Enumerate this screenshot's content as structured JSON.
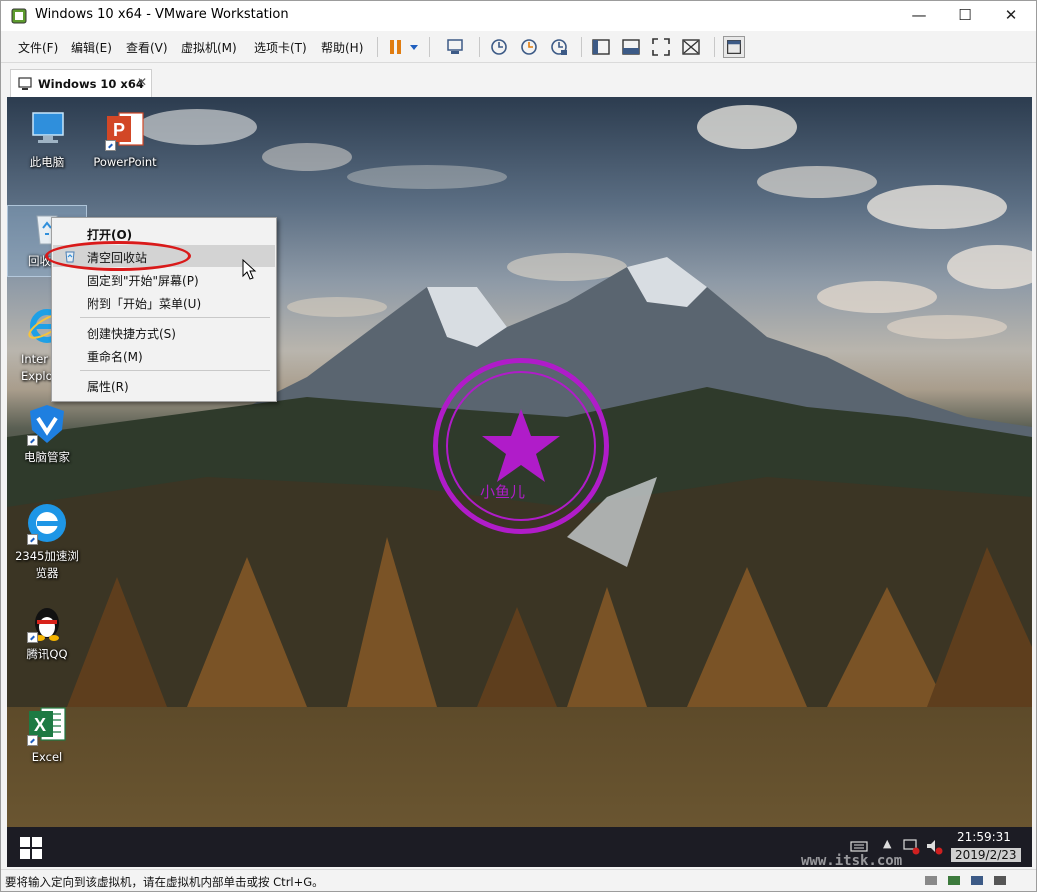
{
  "window": {
    "title": "Windows 10 x64 - VMware Workstation",
    "controls": {
      "minimize": "—",
      "maximize": "☐",
      "close": "✕"
    }
  },
  "menubar": {
    "items": [
      "文件(F)",
      "编辑(E)",
      "查看(V)",
      "虚拟机(M)",
      "选项卡(T)",
      "帮助(H)"
    ]
  },
  "toolbar": {
    "icons": [
      "pause-icon",
      "dropdown-icon",
      "send-ctrl-alt-del-icon",
      "snapshot-icon",
      "revert-snapshot-icon",
      "snapshot-manager-icon",
      "sidebar-icon",
      "console-view-icon",
      "fullscreen-icon",
      "unity-icon",
      "library-icon"
    ]
  },
  "tab": {
    "label": "Windows 10 x64",
    "close": "✕"
  },
  "desktop": {
    "icons": [
      {
        "label": "此电脑",
        "icon": "this-pc-icon"
      },
      {
        "label": "PowerPoint",
        "icon": "powerpoint-icon"
      },
      {
        "label": "回收",
        "icon": "recycle-bin-icon"
      },
      {
        "label": "Inter\nExplo",
        "icon": "internet-explorer-icon"
      },
      {
        "label": "电脑管家",
        "icon": "pc-manager-icon"
      },
      {
        "label": "2345加速浏览器",
        "icon": "browser-2345-icon"
      },
      {
        "label": "腾讯QQ",
        "icon": "qq-icon"
      },
      {
        "label": "Excel",
        "icon": "excel-icon"
      }
    ]
  },
  "context_menu": {
    "items": [
      {
        "label": "打开(O)",
        "bold": true
      },
      {
        "label": "清空回收站",
        "highlighted": true
      },
      {
        "label": "固定到\"开始\"屏幕(P)"
      },
      {
        "label": "附到「开始」菜单(U)"
      },
      {
        "label": "创建快捷方式(S)"
      },
      {
        "label": "重命名(M)"
      },
      {
        "label": "属性(R)"
      }
    ]
  },
  "watermark": {
    "text": "小鱼儿",
    "site": "www.itsk.com"
  },
  "taskbar": {
    "time": "21:59:31",
    "date": "2019/2/23"
  },
  "statusbar": {
    "text": "要将输入定向到该虚拟机，请在虚拟机内部单击或按 Ctrl+G。"
  },
  "colors": {
    "accent_red": "#d91a1a",
    "stamp_purple": "#b01cc9",
    "taskbar": "#1c1c24"
  }
}
